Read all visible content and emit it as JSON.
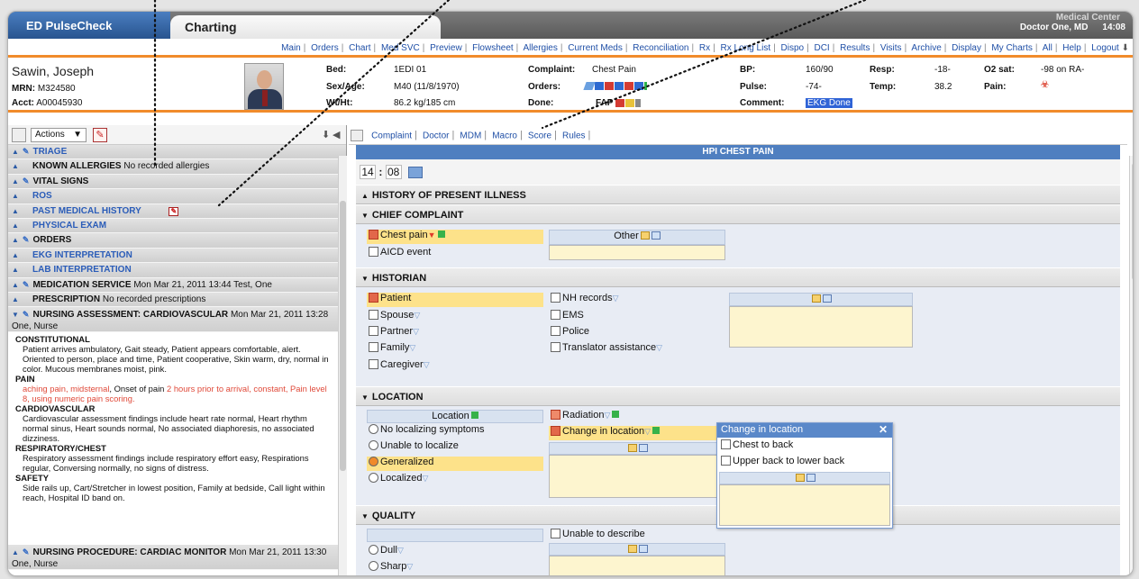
{
  "header": {
    "brand": "ED PulseCheck",
    "active_tab": "Charting",
    "facility": "Medical Center",
    "user": "Doctor One, MD",
    "time": "14:08"
  },
  "nav": {
    "items": [
      "Main",
      "Orders",
      "Chart",
      "Med SVC",
      "Preview",
      "Flowsheet",
      "Allergies",
      "Current Meds",
      "Reconciliation",
      "Rx",
      "Rx Long List",
      "Dispo",
      "DCI",
      "Results",
      "Visits",
      "Archive",
      "Display",
      "My Charts",
      "All",
      "Help",
      "Logout"
    ]
  },
  "patient": {
    "name": "Sawin, Joseph",
    "mrn_label": "MRN:",
    "mrn": "M324580",
    "acct_label": "Acct:",
    "acct": "A00045930",
    "bed_label": "Bed:",
    "bed": "1EDI 01",
    "sexage_label": "Sex/Age:",
    "sexage": "M40 (11/8/1970)",
    "wtht_label": "Wt/Ht:",
    "wtht": "86.2 kg/185 cm",
    "complaint_label": "Complaint:",
    "complaint": "Chest Pain",
    "orders_label": "Orders:",
    "done_label": "Done:",
    "done": "FAP",
    "bp_label": "BP:",
    "bp": "160/90",
    "pulse_label": "Pulse:",
    "pulse": "-74-",
    "comment_label": "Comment:",
    "comment": "EKG Done",
    "resp_label": "Resp:",
    "resp": "-18-",
    "temp_label": "Temp:",
    "temp": "38.2",
    "o2_label": "O2 sat:",
    "o2": "-98 on RA-",
    "pain_label": "Pain:"
  },
  "left": {
    "actions_label": "Actions",
    "sections": {
      "triage": "TRIAGE",
      "allergies": "KNOWN ALLERGIES",
      "allergies_val": "No recorded allergies",
      "vitals": "VITAL SIGNS",
      "ros": "ROS",
      "pmh": "PAST MEDICAL HISTORY",
      "pe": "PHYSICAL EXAM",
      "orders": "ORDERS",
      "ekg": "EKG INTERPRETATION",
      "lab": "LAB INTERPRETATION",
      "medsvc": "MEDICATION SERVICE",
      "medsvc_val": "Mon Mar 21, 2011 13:44 Test, One",
      "rx": "PRESCRIPTION",
      "rx_val": "No recorded prescriptions",
      "nursing": "NURSING ASSESSMENT: CARDIOVASCULAR",
      "nursing_val": "Mon Mar 21, 2011 13:28 One, Nurse",
      "procedure": "NURSING PROCEDURE: CARDIAC MONITOR",
      "procedure_val": "Mon Mar 21, 2011 13:30 One, Nurse"
    },
    "nursing_notes": {
      "h1": "CONSTITUTIONAL",
      "t1": "Patient arrives ambulatory, Gait steady, Patient appears comfortable, alert. Oriented to person, place and time, Patient cooperative, Skin warm, dry, normal in color. Mucous membranes moist, pink.",
      "h2": "PAIN",
      "t2a": "aching pain, midsternal",
      "t2b": ", Onset of pain ",
      "t2c": "2 hours prior to arrival, constant, Pain level 8, using numeric pain scoring.",
      "h3": "CARDIOVASCULAR",
      "t3": "Cardiovascular assessment findings include heart rate normal, Heart rhythm normal sinus, Heart sounds normal, No associated diaphoresis, no associated dizziness.",
      "h4": "RESPIRATORY/CHEST",
      "t4": "Respiratory assessment findings include respiratory effort easy, Respirations regular, Conversing normally, no signs of distress.",
      "h5": "SAFETY",
      "t5": "Side rails up, Cart/Stretcher in lowest position, Family at bedside, Call light within reach, Hospital ID band on."
    }
  },
  "maintabs": [
    "Complaint",
    "Doctor",
    "MDM",
    "Macro",
    "Score",
    "Rules"
  ],
  "main": {
    "hpi_title": "HPI CHEST PAIN",
    "time_h": "14",
    "time_m": "08",
    "sec_hpi": "HISTORY OF PRESENT ILLNESS",
    "sec_cc": "CHIEF COMPLAINT",
    "sec_hist": "HISTORIAN",
    "sec_loc": "LOCATION",
    "sec_qual": "QUALITY",
    "cc": {
      "chest_pain": "Chest pain",
      "aicd": "AICD event",
      "other": "Other"
    },
    "hist": {
      "patient": "Patient",
      "spouse": "Spouse",
      "partner": "Partner",
      "family": "Family",
      "caregiver": "Caregiver",
      "nh": "NH records",
      "ems": "EMS",
      "police": "Police",
      "translator": "Translator assistance"
    },
    "loc": {
      "location": "Location",
      "no_local": "No localizing symptoms",
      "unable": "Unable to localize",
      "generalized": "Generalized",
      "localized": "Localized",
      "radiation": "Radiation",
      "change": "Change in location"
    },
    "qual": {
      "unable": "Unable to describe",
      "dull": "Dull",
      "sharp": "Sharp"
    }
  },
  "popup": {
    "title": "Change in location",
    "opt1": "Chest to back",
    "opt2": "Upper back to lower back"
  }
}
